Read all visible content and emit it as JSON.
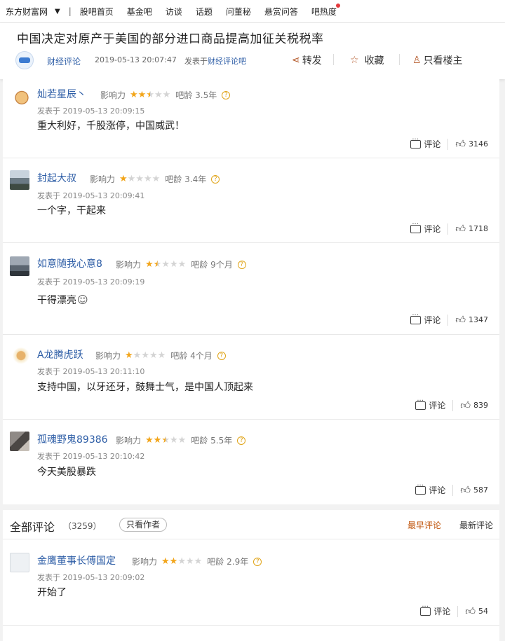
{
  "topnav": {
    "brand": "东方财富网",
    "caret": "▼",
    "sep": "|",
    "items": [
      "股吧首页",
      "基金吧",
      "访谈",
      "话题",
      "问董秘",
      "悬赏问答",
      "吧热度"
    ]
  },
  "post": {
    "title": "中国决定对原产于美国的部分进口商品提高加征关税税率",
    "author": "财经评论",
    "time": "2019-05-13 20:07:47",
    "posted_prefix": "发表于",
    "posted_bar": "财经评论吧",
    "share_label": "转发",
    "fav_label": "收藏",
    "only_op_label": "只看楼主"
  },
  "labels": {
    "influence": "影响力",
    "age": "吧龄",
    "posted_at": "发表于",
    "comment": "评论"
  },
  "hot_comments": [
    {
      "user": "灿若星辰丶",
      "stars": 2.5,
      "age": "3.5年",
      "time": "2019-05-13 20:09:15",
      "text": "重大利好，千股涨停，中国威武！",
      "likes": "3146"
    },
    {
      "user": "封起大叔",
      "stars": 1,
      "age": "3.4年",
      "time": "2019-05-13 20:09:41",
      "text": "一个字，干起来",
      "likes": "1718"
    },
    {
      "user": "如意随我心意8",
      "stars": 1.5,
      "age": "9个月",
      "time": "2019-05-13 20:09:19",
      "text": "干得漂亮",
      "likes": "1347"
    },
    {
      "user": "A龙腾虎跃",
      "stars": 1,
      "age": "4个月",
      "time": "2019-05-13 20:11:10",
      "text": "支持中国，以牙还牙，鼓舞士气，是中国人顶起来",
      "likes": "839"
    },
    {
      "user": "孤魂野鬼89386",
      "stars": 2.5,
      "age": "5.5年",
      "time": "2019-05-13 20:10:42",
      "text": "今天美股暴跌",
      "likes": "587"
    }
  ],
  "all_comments": {
    "title": "全部评论",
    "count": "（3259）",
    "only_author": "只看作者",
    "earliest": "最早评论",
    "newest": "最新评论"
  },
  "bottom_comments": [
    {
      "user": "金鹰董事长傅国定",
      "stars": 2,
      "age": "2.9年",
      "time": "2019-05-13 20:09:02",
      "text": "开始了",
      "likes": "54"
    }
  ],
  "colors": {
    "link_blue": "#2d5da6",
    "star_gold": "#f2a51a",
    "accent_orange": "#c0550c"
  }
}
